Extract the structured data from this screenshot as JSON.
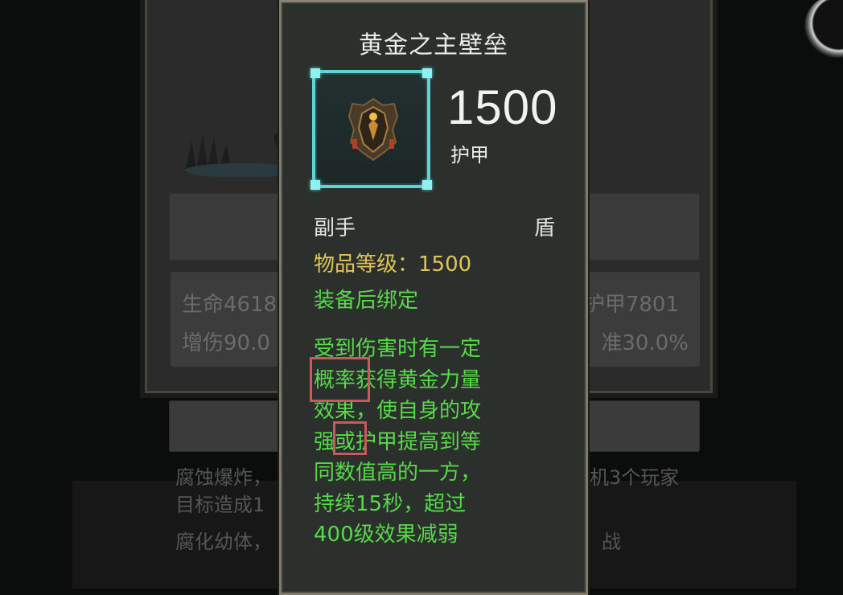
{
  "background": {
    "stat_left_1": "生命4618",
    "stat_right_1": "护甲7801",
    "stat_left_2": "增伤90.0",
    "stat_right_2": "准30.0%",
    "desc_line_1_left": "腐蚀爆炸，",
    "desc_line_1_right": "机3个玩家",
    "desc_line_2_left": "目标造成1",
    "desc_line_3_left": "腐化幼体，",
    "desc_line_3_right": "战"
  },
  "tooltip": {
    "title": "黄金之主壁垒",
    "armor_value": "1500",
    "armor_label": "护甲",
    "slot": "副手",
    "item_type": "盾",
    "item_level": "物品等级：1500",
    "bind_text": "装备后绑定",
    "effect_lines": [
      "受到伤害时有一定",
      "概率获得黄金力量",
      "效果，使自身的攻",
      "强或护甲提高到等",
      "同数值高的一方，",
      "持续15秒，超过",
      "400级效果减弱"
    ]
  },
  "colors": {
    "rarity_frame": "#5fd3d6",
    "effect_text": "#57d94a",
    "item_level_text": "#e0c45a",
    "highlight_box": "#c85a5c"
  },
  "icons": {
    "item": "shield-icon"
  }
}
